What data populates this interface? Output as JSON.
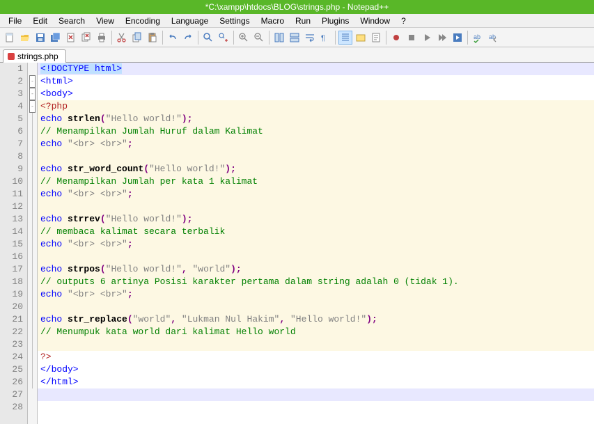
{
  "window": {
    "title": "*C:\\xampp\\htdocs\\BLOG\\strings.php - Notepad++"
  },
  "menu": {
    "items": [
      "File",
      "Edit",
      "Search",
      "View",
      "Encoding",
      "Language",
      "Settings",
      "Macro",
      "Run",
      "Plugins",
      "Window",
      "?"
    ]
  },
  "tab": {
    "label": "strings.php"
  },
  "code": {
    "l1": "<!DOCTYPE html>",
    "l2": "<html>",
    "l3": "<body>",
    "l4": "<?php",
    "l5a": "echo",
    "l5b": "strlen",
    "l5c": "(",
    "l5d": "\"Hello world!\"",
    "l5e": ");",
    "l6": "// Menampilkan Jumlah Huruf dalam Kalimat",
    "l7a": "echo",
    "l7b": "\"<br> <br>\"",
    "l7c": ";",
    "l9a": "echo",
    "l9b": "str_word_count",
    "l9c": "(",
    "l9d": "\"Hello world!\"",
    "l9e": ");",
    "l10": "// Menampilkan Jumlah per kata 1 kalimat",
    "l11a": "echo",
    "l11b": "\"<br> <br>\"",
    "l11c": ";",
    "l13a": "echo",
    "l13b": "strrev",
    "l13c": "(",
    "l13d": "\"Hello world!\"",
    "l13e": ");",
    "l14": "// membaca kalimat secara terbalik",
    "l15a": "echo",
    "l15b": "\"<br> <br>\"",
    "l15c": ";",
    "l17a": "echo",
    "l17b": "strpos",
    "l17c": "(",
    "l17d": "\"Hello world!\"",
    "l17e": ",",
    "l17f": "\"world\"",
    "l17g": ");",
    "l18": "// outputs 6 artinya Posisi karakter pertama dalam string adalah 0 (tidak 1).",
    "l19a": "echo",
    "l19b": "\"<br> <br>\"",
    "l19c": ";",
    "l21a": "echo",
    "l21b": "str_replace",
    "l21c": "(",
    "l21d": "\"world\"",
    "l21e": ",",
    "l21f": "\"Lukman Nul Hakim\"",
    "l21g": ",",
    "l21h": "\"Hello world!\"",
    "l21i": ");",
    "l22": "// Menumpuk kata world dari kalimat Hello world",
    "l24": "?>",
    "l25": "</body>",
    "l26": "</html>"
  },
  "lines": 28
}
